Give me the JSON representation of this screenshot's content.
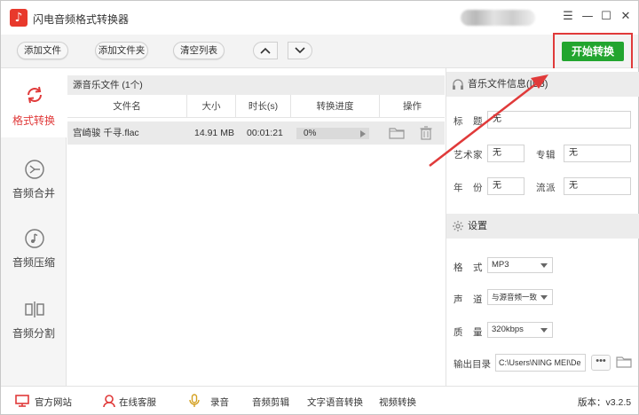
{
  "app": {
    "title": "闪电音频格式转换器",
    "logo_glyph": "♪"
  },
  "window_controls": {
    "menu": "☰",
    "minimize": "—",
    "maximize": "☐",
    "close": "✕"
  },
  "toolbar": {
    "add_file": "添加文件",
    "add_folder": "添加文件夹",
    "clear_list": "清空列表",
    "start": "开始转换"
  },
  "sidebar": {
    "items": [
      {
        "label": "格式转换",
        "icon": "refresh-icon",
        "active": true
      },
      {
        "label": "音频合并",
        "icon": "merge-icon",
        "active": false
      },
      {
        "label": "音频压缩",
        "icon": "music-note-icon",
        "active": false
      },
      {
        "label": "音频分割",
        "icon": "split-icon",
        "active": false
      }
    ]
  },
  "filelist": {
    "header": "源音乐文件 (1个)",
    "columns": [
      "文件名",
      "大小",
      "时长(s)",
      "转换进度",
      "操作"
    ],
    "rows": [
      {
        "name": "宫崎骏 千寻.flac",
        "size": "14.91 MB",
        "duration": "00:01:21",
        "progress_text": "0%",
        "progress": 0
      }
    ]
  },
  "info_panel": {
    "title": "音乐文件信息(ID3)",
    "title_label": "标　题",
    "title_value": "无",
    "artist_label": "艺术家",
    "artist_value": "无",
    "album_label": "专辑",
    "album_value": "无",
    "year_label": "年　份",
    "year_value": "无",
    "genre_label": "流派",
    "genre_value": "无"
  },
  "settings": {
    "title": "设置",
    "format_label": "格　式",
    "format_value": "MP3",
    "channel_label": "声　道",
    "channel_value": "与源音频一致",
    "quality_label": "质　量",
    "quality_value": "320kbps",
    "output_label": "输出目录",
    "output_value": "C:\\Users\\NING MEI\\De",
    "dots": "•••"
  },
  "bottombar": {
    "website": "官方网站",
    "support": "在线客服",
    "record": "录音",
    "edit": "音频剪辑",
    "tts": "文字语音转换",
    "video": "视频转换",
    "version": "版本：v3.2.5"
  },
  "colors": {
    "accent_red": "#e03a3a",
    "start_green": "#22a52f",
    "progress_blue": "#6aa7e6"
  }
}
